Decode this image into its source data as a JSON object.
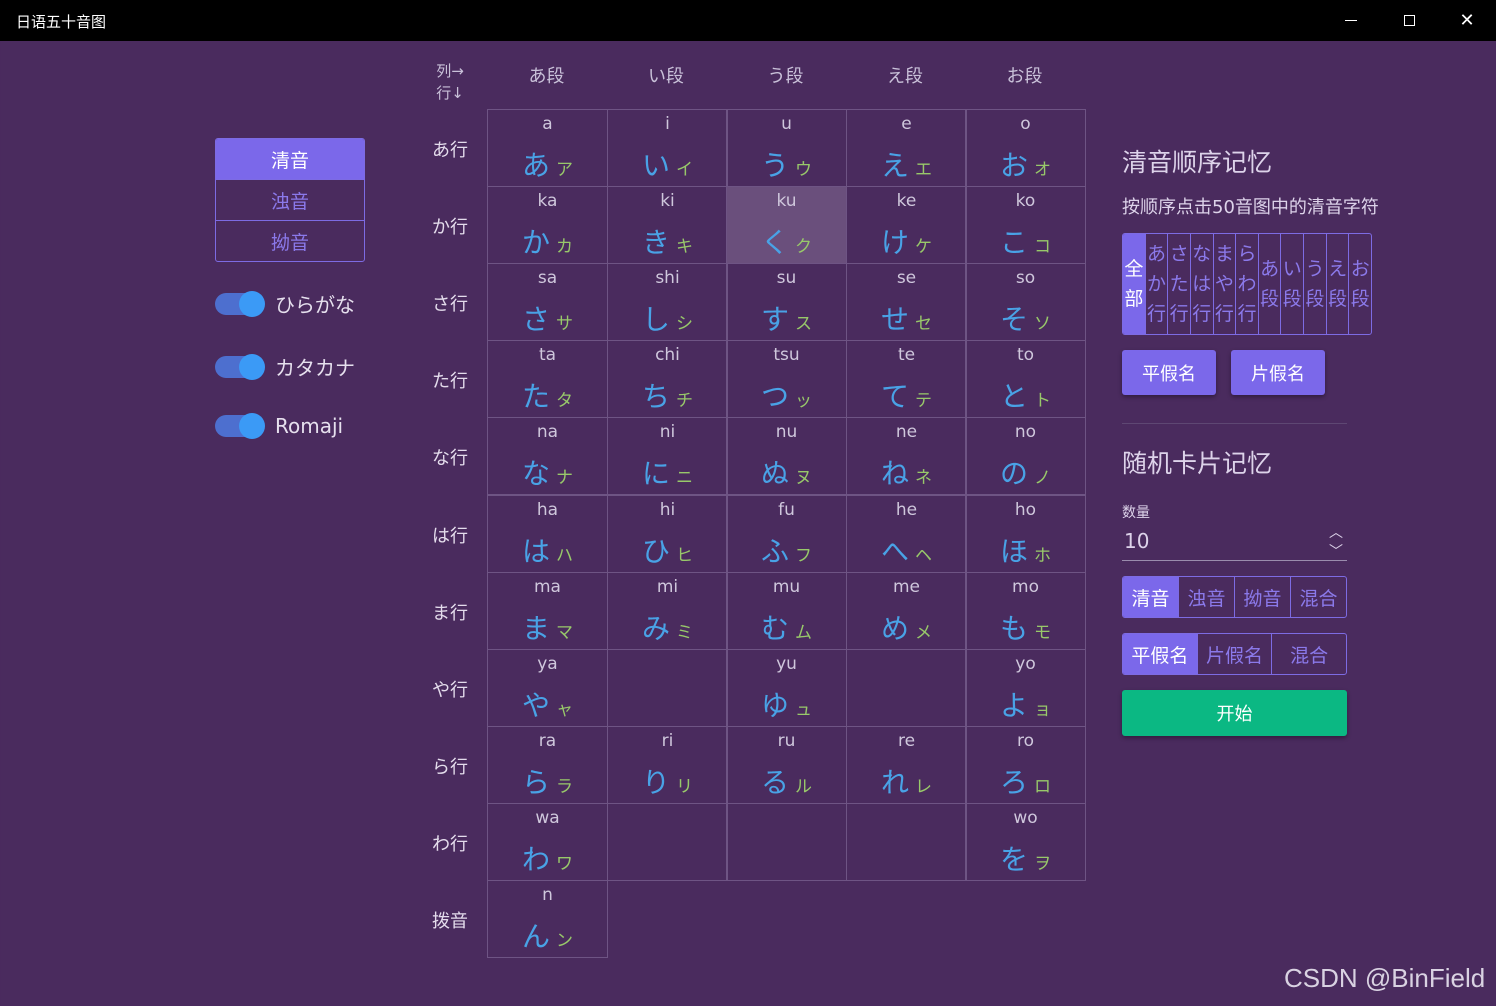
{
  "window": {
    "title": "日语五十音图",
    "minimize": "—",
    "maximize": "□",
    "close": "✕"
  },
  "left": {
    "modes": [
      "清音",
      "浊音",
      "拗音"
    ],
    "toggles": [
      "ひらがな",
      "カタカナ",
      "Romaji"
    ]
  },
  "table": {
    "corner_top": "列→",
    "corner_bottom": "行↓",
    "columns": [
      "あ段",
      "い段",
      "う段",
      "え段",
      "お段"
    ],
    "row_labels": [
      "あ行",
      "か行",
      "さ行",
      "た行",
      "な行",
      "は行",
      "ま行",
      "や行",
      "ら行",
      "わ行",
      "拨音"
    ],
    "cells": [
      [
        {
          "r": "a",
          "h": "あ",
          "k": "ア"
        },
        {
          "r": "i",
          "h": "い",
          "k": "イ"
        },
        {
          "r": "u",
          "h": "う",
          "k": "ウ"
        },
        {
          "r": "e",
          "h": "え",
          "k": "エ"
        },
        {
          "r": "o",
          "h": "お",
          "k": "オ"
        }
      ],
      [
        {
          "r": "ka",
          "h": "か",
          "k": "カ"
        },
        {
          "r": "ki",
          "h": "き",
          "k": "キ"
        },
        {
          "r": "ku",
          "h": "く",
          "k": "ク"
        },
        {
          "r": "ke",
          "h": "け",
          "k": "ケ"
        },
        {
          "r": "ko",
          "h": "こ",
          "k": "コ"
        }
      ],
      [
        {
          "r": "sa",
          "h": "さ",
          "k": "サ"
        },
        {
          "r": "shi",
          "h": "し",
          "k": "シ"
        },
        {
          "r": "su",
          "h": "す",
          "k": "ス"
        },
        {
          "r": "se",
          "h": "せ",
          "k": "セ"
        },
        {
          "r": "so",
          "h": "そ",
          "k": "ソ"
        }
      ],
      [
        {
          "r": "ta",
          "h": "た",
          "k": "タ"
        },
        {
          "r": "chi",
          "h": "ち",
          "k": "チ"
        },
        {
          "r": "tsu",
          "h": "つ",
          "k": "ッ"
        },
        {
          "r": "te",
          "h": "て",
          "k": "テ"
        },
        {
          "r": "to",
          "h": "と",
          "k": "ト"
        }
      ],
      [
        {
          "r": "na",
          "h": "な",
          "k": "ナ"
        },
        {
          "r": "ni",
          "h": "に",
          "k": "ニ"
        },
        {
          "r": "nu",
          "h": "ぬ",
          "k": "ヌ"
        },
        {
          "r": "ne",
          "h": "ね",
          "k": "ネ"
        },
        {
          "r": "no",
          "h": "の",
          "k": "ノ"
        }
      ],
      [
        {
          "r": "ha",
          "h": "は",
          "k": "ハ"
        },
        {
          "r": "hi",
          "h": "ひ",
          "k": "ヒ"
        },
        {
          "r": "fu",
          "h": "ふ",
          "k": "フ"
        },
        {
          "r": "he",
          "h": "へ",
          "k": "ヘ"
        },
        {
          "r": "ho",
          "h": "ほ",
          "k": "ホ"
        }
      ],
      [
        {
          "r": "ma",
          "h": "ま",
          "k": "マ"
        },
        {
          "r": "mi",
          "h": "み",
          "k": "ミ"
        },
        {
          "r": "mu",
          "h": "む",
          "k": "ム"
        },
        {
          "r": "me",
          "h": "め",
          "k": "メ"
        },
        {
          "r": "mo",
          "h": "も",
          "k": "モ"
        }
      ],
      [
        {
          "r": "ya",
          "h": "や",
          "k": "ャ"
        },
        null,
        {
          "r": "yu",
          "h": "ゆ",
          "k": "ュ"
        },
        null,
        {
          "r": "yo",
          "h": "よ",
          "k": "ョ"
        }
      ],
      [
        {
          "r": "ra",
          "h": "ら",
          "k": "ラ"
        },
        {
          "r": "ri",
          "h": "り",
          "k": "リ"
        },
        {
          "r": "ru",
          "h": "る",
          "k": "ル"
        },
        {
          "r": "re",
          "h": "れ",
          "k": "レ"
        },
        {
          "r": "ro",
          "h": "ろ",
          "k": "ロ"
        }
      ],
      [
        {
          "r": "wa",
          "h": "わ",
          "k": "ワ"
        },
        null,
        null,
        null,
        {
          "r": "wo",
          "h": "を",
          "k": "ヲ"
        }
      ],
      [
        {
          "r": "n",
          "h": "ん",
          "k": "ン"
        }
      ]
    ],
    "highlight": "ku"
  },
  "right": {
    "order_title": "清音顺序记忆",
    "order_hint": "按顺序点击50音图中的清音字符",
    "filters": [
      "全部",
      "あか行",
      "さた行",
      "なは行",
      "まや行",
      "らわ行",
      "あ段",
      "い段",
      "う段",
      "え段",
      "お段"
    ],
    "hiragana_btn": "平假名",
    "katakana_btn": "片假名",
    "random_title": "随机卡片记忆",
    "count_label": "数量",
    "count_value": "10",
    "sound_options": [
      "清音",
      "浊音",
      "拗音",
      "混合"
    ],
    "script_options": [
      "平假名",
      "片假名",
      "混合"
    ],
    "start_btn": "开始"
  },
  "watermark": "CSDN @BinField",
  "colors": {
    "background": "#4a2b5e",
    "accent": "#7b68ea",
    "hiragana": "#49a2e6",
    "katakana": "#98c86a",
    "start": "#0bb883"
  }
}
